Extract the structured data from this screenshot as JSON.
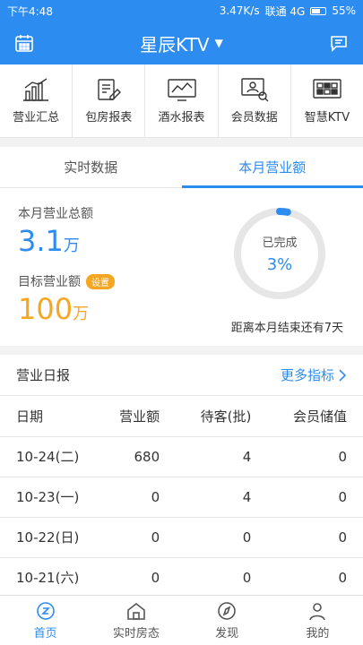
{
  "status": {
    "time": "下午4:48",
    "speed": "3.47K/s",
    "carrier": "联通 4G",
    "battery": "55%"
  },
  "appbar": {
    "title": "星辰KTV",
    "caret": "▼",
    "left_icon": "calendar-icon",
    "right_icon": "chat-icon"
  },
  "shortcuts": [
    {
      "label": "营业汇总",
      "icon": "bar-chart-icon"
    },
    {
      "label": "包房报表",
      "icon": "document-edit-icon"
    },
    {
      "label": "酒水报表",
      "icon": "monitor-chart-icon"
    },
    {
      "label": "会员数据",
      "icon": "member-screen-icon"
    },
    {
      "label": "智慧KTV",
      "icon": "smart-grid-icon"
    }
  ],
  "tabs": [
    {
      "label": "实时数据",
      "active": false
    },
    {
      "label": "本月营业额",
      "active": true
    }
  ],
  "summary": {
    "total_label": "本月营业总额",
    "total_value": "3.1",
    "total_unit": "万",
    "target_label": "目标营业额",
    "target_badge": "设置",
    "target_value": "100",
    "target_unit": "万",
    "progress_label": "已完成",
    "progress_text": "3%",
    "progress_fraction": 0.03,
    "remaining": "距离本月结束还有7天"
  },
  "report": {
    "title": "营业日报",
    "more": "更多指标",
    "headers": [
      "日期",
      "营业额",
      "待客(批)",
      "会员储值"
    ],
    "rows": [
      [
        "10-24(二)",
        "680",
        "4",
        "0"
      ],
      [
        "10-23(一)",
        "0",
        "4",
        "0"
      ],
      [
        "10-22(日)",
        "0",
        "0",
        "0"
      ],
      [
        "10-21(六)",
        "0",
        "0",
        "0"
      ]
    ]
  },
  "tabbar": [
    {
      "label": "首页",
      "icon": "home-icon",
      "active": true
    },
    {
      "label": "实时房态",
      "icon": "room-status-icon",
      "active": false
    },
    {
      "label": "发现",
      "icon": "compass-icon",
      "active": false
    },
    {
      "label": "我的",
      "icon": "person-icon",
      "active": false
    }
  ],
  "colors": {
    "primary": "#2d8cf0",
    "accent": "#f5a623"
  }
}
